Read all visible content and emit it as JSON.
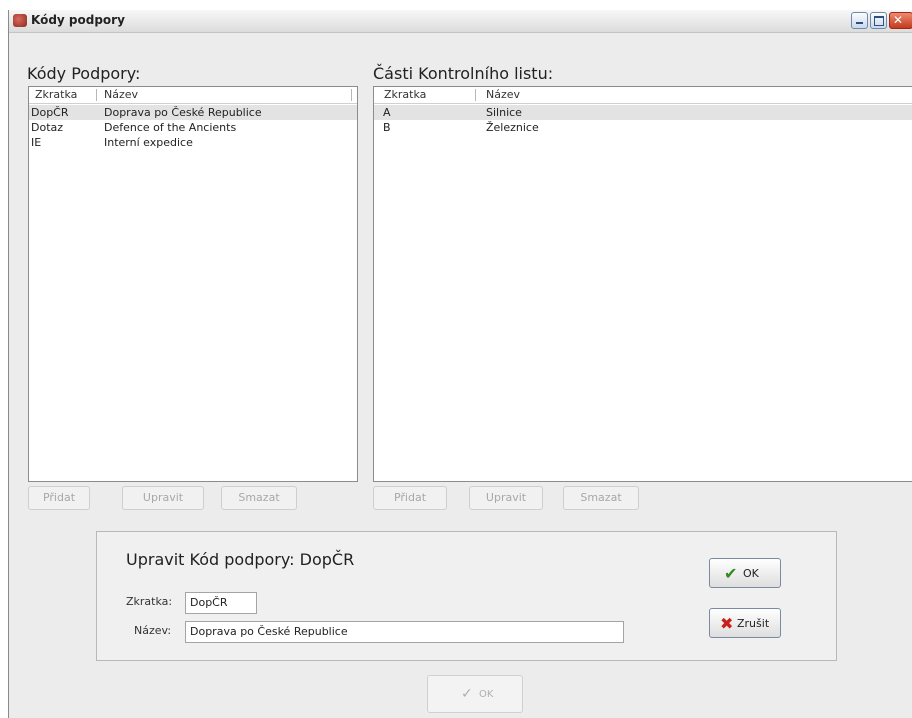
{
  "window": {
    "title": "Kódy podpory"
  },
  "left_panel": {
    "title": "Kódy Podpory:",
    "columns": [
      "Zkratka",
      "Název"
    ],
    "rows": [
      [
        "DopČR",
        "Doprava po České Republice"
      ],
      [
        "Dotaz",
        "Defence of the Ancients"
      ],
      [
        "IE",
        "Interní expedice"
      ]
    ],
    "selected_row": 0,
    "buttons": {
      "add": "Přidat",
      "edit": "Upravit",
      "delete": "Smazat"
    }
  },
  "right_panel": {
    "title": "Části Kontrolního listu:",
    "columns": [
      "Zkratka",
      "Název"
    ],
    "rows": [
      [
        "A",
        "Silnice"
      ],
      [
        "B",
        "Železnice"
      ]
    ],
    "selected_row": 0,
    "buttons": {
      "add": "Přidat",
      "edit": "Upravit",
      "delete": "Smazat"
    }
  },
  "edit_form": {
    "title": "Upravit Kód podpory: DopČR",
    "abbr_label": "Zkratka:",
    "abbr_value": "DopČR",
    "name_label": "Název:",
    "name_value": "Doprava po České Republice",
    "ok_label": "OK",
    "cancel_label": "Zrušit"
  },
  "footer": {
    "ok_label": "OK"
  },
  "colors": {
    "ok_icon": "#2f8a1f",
    "cancel_icon": "#c8201a"
  },
  "icons": {
    "ok": "check-icon",
    "cancel": "cross-icon"
  }
}
